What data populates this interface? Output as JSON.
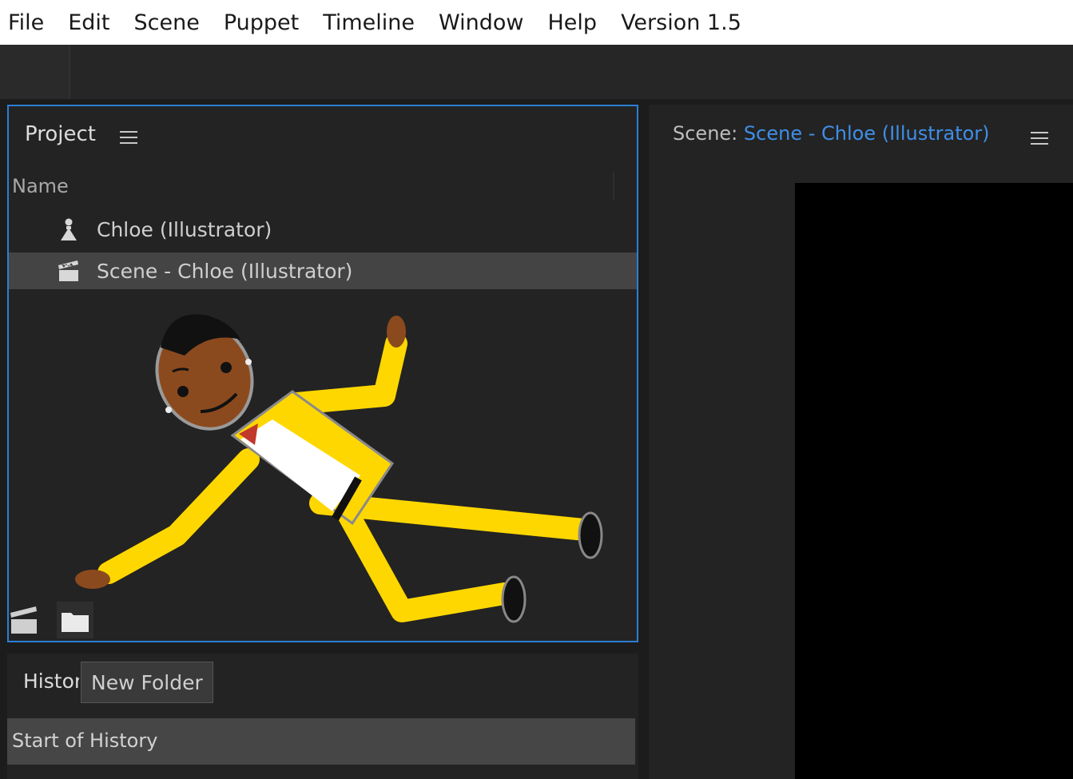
{
  "menu": [
    "File",
    "Edit",
    "Scene",
    "Puppet",
    "Timeline",
    "Window",
    "Help",
    "Version 1.5"
  ],
  "project": {
    "title": "Project",
    "column_name": "Name",
    "items": [
      {
        "label": "Chloe (Illustrator)",
        "icon": "puppet-icon",
        "selected": false
      },
      {
        "label": "Scene - Chloe (Illustrator)",
        "icon": "clapperboard-icon",
        "selected": true
      }
    ]
  },
  "history": {
    "title": "History",
    "tooltip": "New Folder",
    "items": [
      "Start of History"
    ]
  },
  "scene": {
    "label": "Scene:",
    "name": "Scene - Chloe (Illustrator)"
  },
  "colors": {
    "accent": "#2d7fd2",
    "link": "#3f8fe8",
    "suit": "#ffd700",
    "skin": "#8b4a1e"
  }
}
